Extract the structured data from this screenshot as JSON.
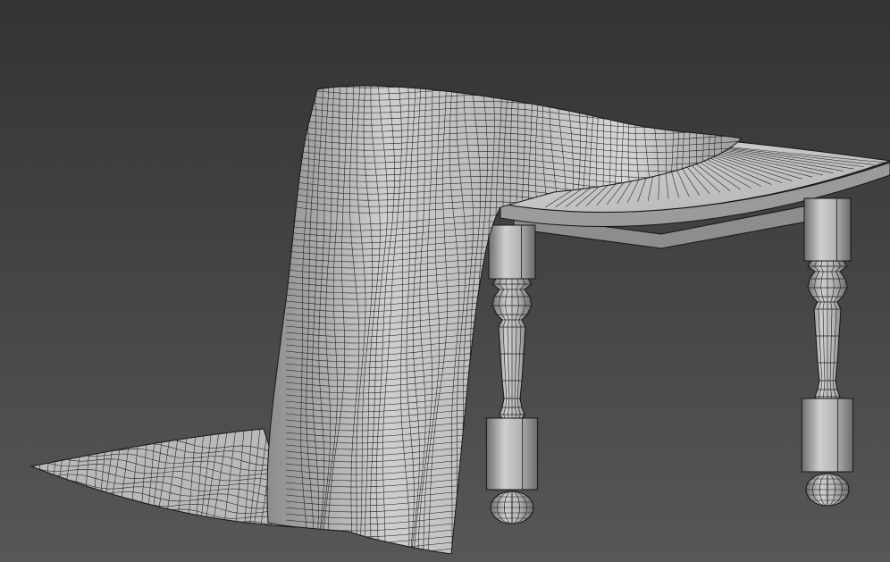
{
  "viewport": {
    "view_name": "",
    "shading_mode": "",
    "wireframe_overlay": true
  },
  "colors": {
    "background_top": "#333333",
    "background_bottom": "#575757",
    "surface_light": "#d4d4d4",
    "surface_mid": "#a9a9a9",
    "surface_dark": "#7a7a7a",
    "wire": "#161616"
  },
  "scene_objects": [
    {
      "name": "table-top",
      "icon": "half-round-tabletop"
    },
    {
      "name": "table-leg-front",
      "icon": "turned-leg"
    },
    {
      "name": "table-leg-right",
      "icon": "turned-leg"
    },
    {
      "name": "tablecloth",
      "icon": "draped-cloth-mesh"
    }
  ]
}
